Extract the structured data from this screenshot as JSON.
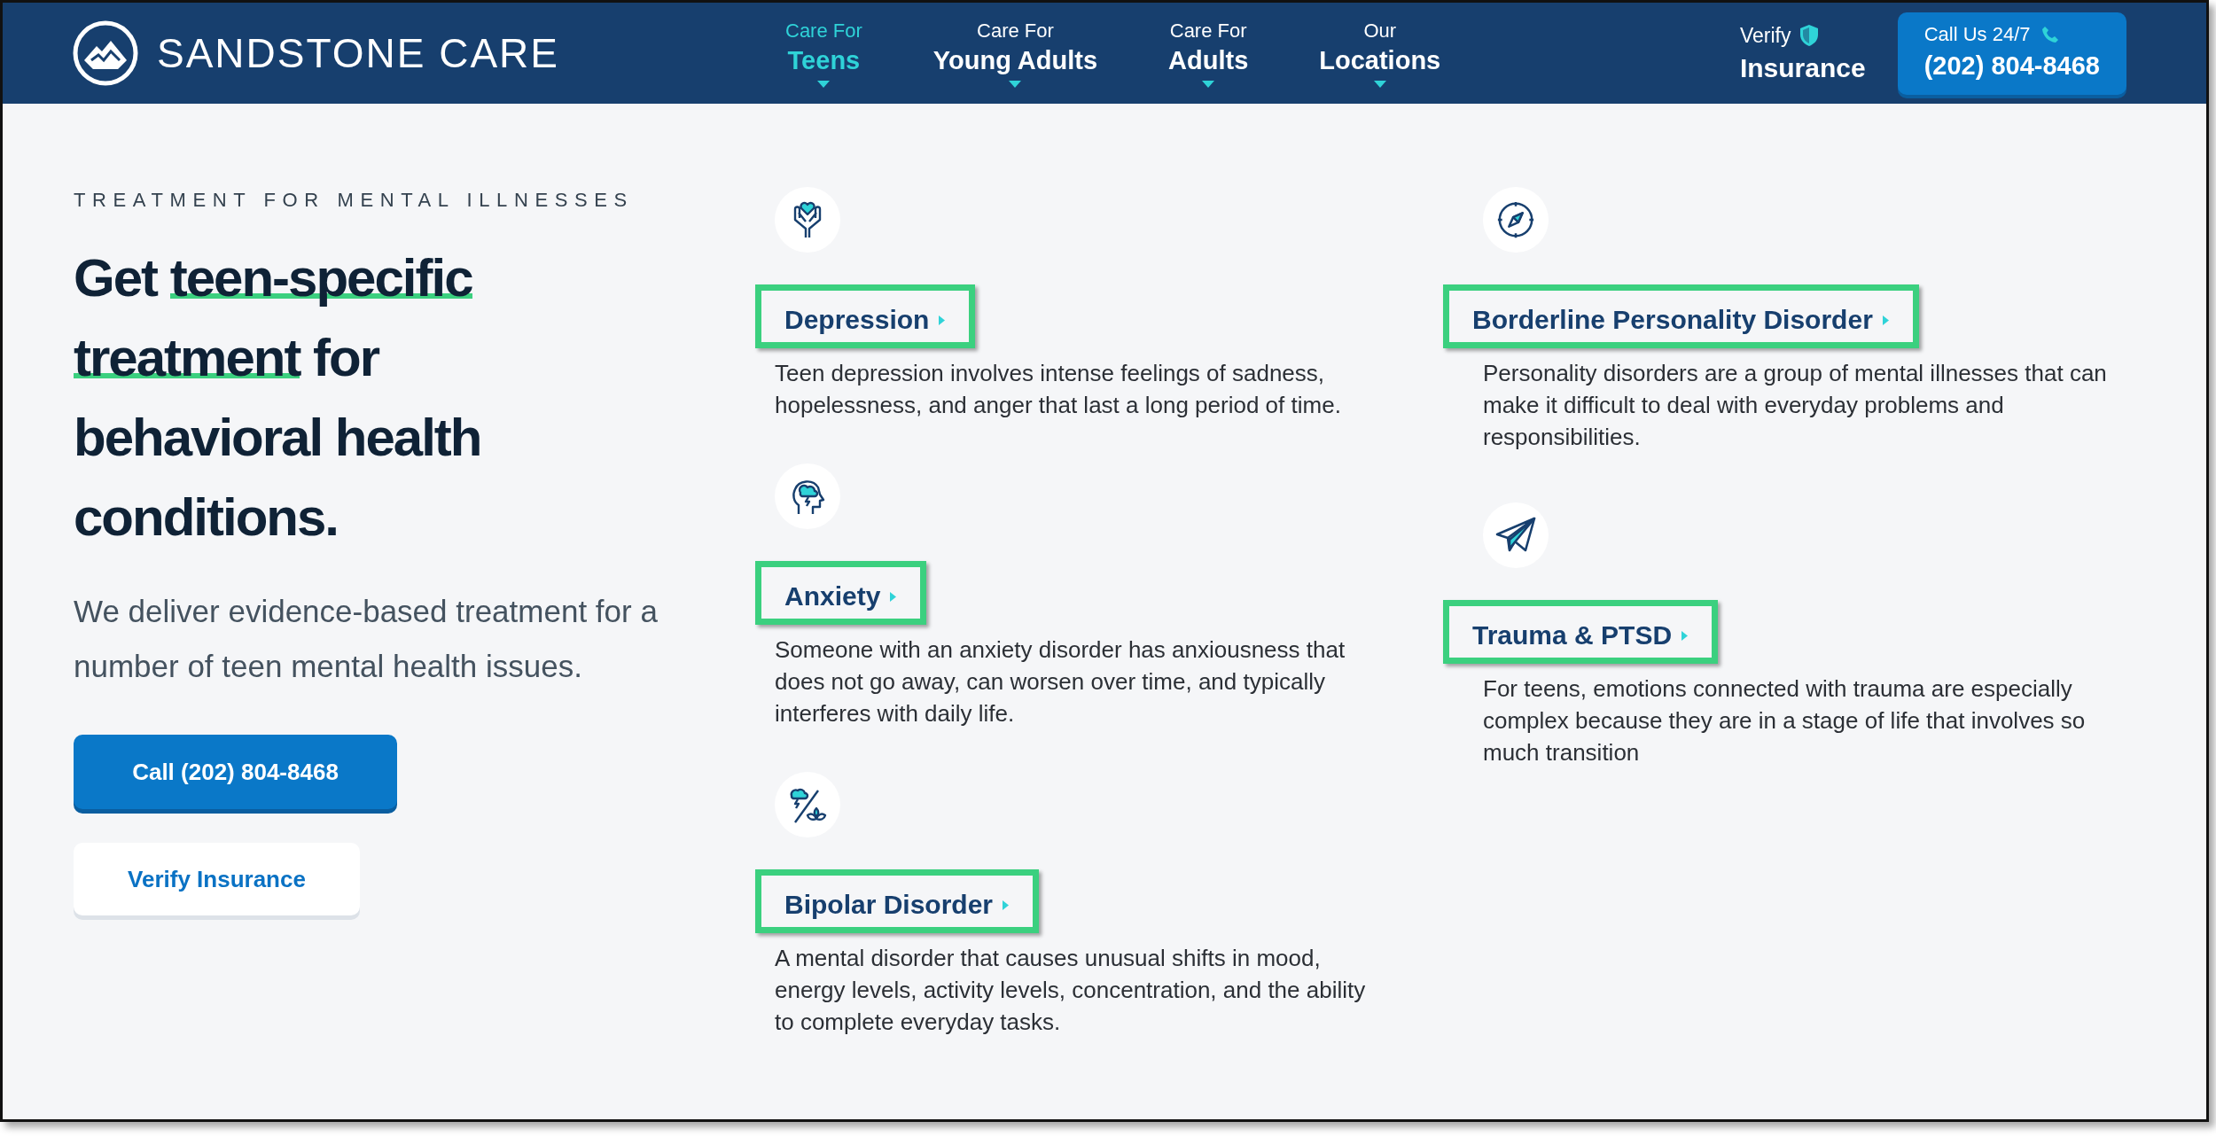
{
  "header": {
    "logo": "SANDSTONE CARE",
    "nav": [
      {
        "top": "Care For",
        "bottom": "Teens",
        "selected": true
      },
      {
        "top": "Care For",
        "bottom": "Young Adults",
        "selected": false
      },
      {
        "top": "Care For",
        "bottom": "Adults",
        "selected": false
      },
      {
        "top": "Our",
        "bottom": "Locations",
        "selected": false
      }
    ],
    "verify": {
      "top": "Verify",
      "bottom": "Insurance"
    },
    "call": {
      "top": "Call Us 24/7",
      "bottom": "(202) 804-8468"
    }
  },
  "hero": {
    "eyebrow": "TREATMENT FOR MENTAL ILLNESSES",
    "headline": [
      [
        {
          "text": "Get ",
          "underlined": false
        },
        {
          "text": "teen-specific",
          "underlined": true
        }
      ],
      [
        {
          "text": "treatment",
          "underlined": true
        },
        {
          "text": " for",
          "underlined": false
        }
      ],
      [
        {
          "text": "behavioral health",
          "underlined": false
        }
      ],
      [
        {
          "text": "conditions.",
          "underlined": false
        }
      ]
    ],
    "body": "We deliver evidence-based treatment for a number of teen mental health issues.",
    "buttons": [
      {
        "label": "Call (202) 804-8468",
        "kind": "primary"
      },
      {
        "label": "Verify Insurance",
        "kind": "secondary"
      }
    ]
  },
  "conditions": [
    [
      {
        "title": "Depression",
        "highlighted": true,
        "text": "Teen depression involves intense feelings of sadness, hopelessness, and anger that last a long period of time."
      },
      {
        "title": "Anxiety",
        "highlighted": true,
        "text": "Someone with an anxiety disorder has anxiousness that does not go away, can worsen over time, and typically interferes with daily life."
      },
      {
        "title": "Bipolar Disorder",
        "highlighted": true,
        "text": "A mental disorder that causes unusual shifts in mood, energy levels, activity levels, concentration, and the ability to complete everyday tasks."
      }
    ],
    [
      {
        "title": "Borderline Personality Disorder",
        "highlighted": true,
        "text": "Personality disorders are a group of mental illnesses that can make it difficult to deal with everyday problems and responsibilities."
      },
      {
        "title": "Trauma & PTSD",
        "highlighted": true,
        "text": "For teens, emotions connected with trauma are especially complex because they are in a stage of life that involves so much transition"
      }
    ]
  ]
}
